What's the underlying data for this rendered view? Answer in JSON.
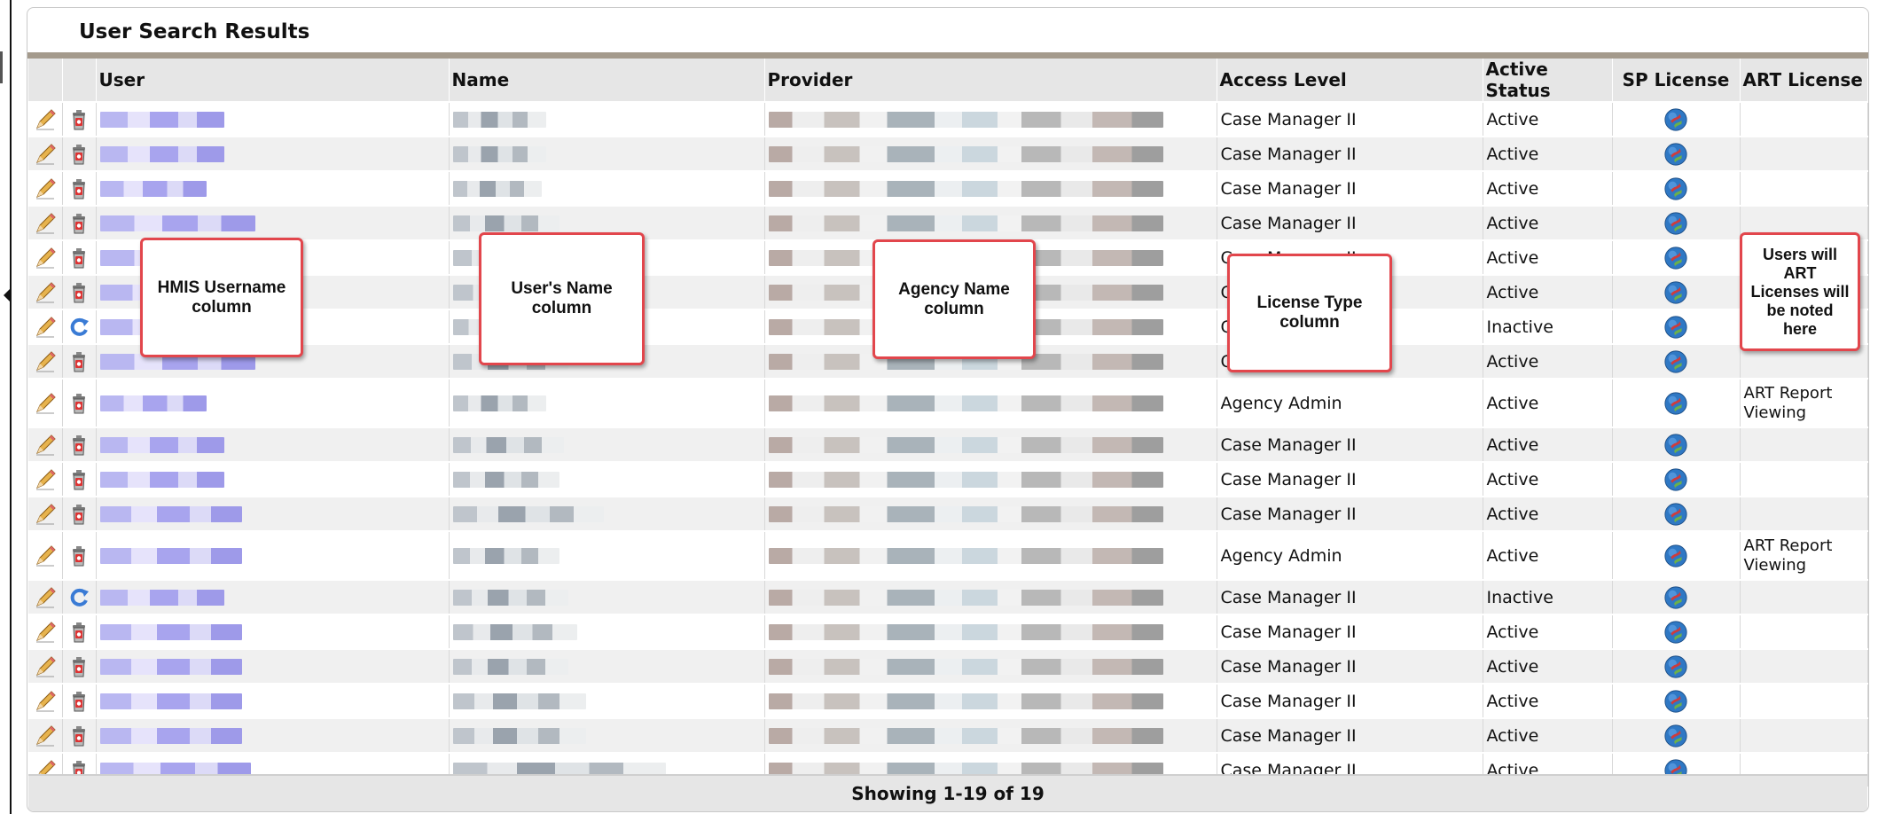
{
  "panel": {
    "title": "User Search Results"
  },
  "columns": {
    "user": "User",
    "name": "Name",
    "provider": "Provider",
    "access_level": "Access Level",
    "active_status": "Active Status",
    "sp_license": "SP License",
    "art_license": "ART License"
  },
  "rows": [
    {
      "action": "delete-icon",
      "access_level": "Case Manager II",
      "status": "Active",
      "art_license": ""
    },
    {
      "action": "delete-icon",
      "access_level": "Case Manager II",
      "status": "Active",
      "art_license": ""
    },
    {
      "action": "delete-icon",
      "access_level": "Case Manager II",
      "status": "Active",
      "art_license": ""
    },
    {
      "action": "delete-icon",
      "access_level": "Case Manager II",
      "status": "Active",
      "art_license": ""
    },
    {
      "action": "delete-icon",
      "access_level": "Case Manager II",
      "status": "Active",
      "art_license": ""
    },
    {
      "action": "delete-icon",
      "access_level": "Case Manager II",
      "status": "Active",
      "art_license": ""
    },
    {
      "action": "activate-icon",
      "access_level": "Case Manager II",
      "status": "Inactive",
      "art_license": ""
    },
    {
      "action": "delete-icon",
      "access_level": "Case Manager II",
      "status": "Active",
      "art_license": ""
    },
    {
      "action": "delete-icon",
      "access_level": "Agency Admin",
      "status": "Active",
      "art_license": "ART Report Viewing"
    },
    {
      "action": "delete-icon",
      "access_level": "Case Manager II",
      "status": "Active",
      "art_license": ""
    },
    {
      "action": "delete-icon",
      "access_level": "Case Manager II",
      "status": "Active",
      "art_license": ""
    },
    {
      "action": "delete-icon",
      "access_level": "Case Manager II",
      "status": "Active",
      "art_license": ""
    },
    {
      "action": "delete-icon",
      "access_level": "Agency Admin",
      "status": "Active",
      "art_license": "ART Report Viewing"
    },
    {
      "action": "activate-icon",
      "access_level": "Case Manager II",
      "status": "Inactive",
      "art_license": ""
    },
    {
      "action": "delete-icon",
      "access_level": "Case Manager II",
      "status": "Active",
      "art_license": ""
    },
    {
      "action": "delete-icon",
      "access_level": "Case Manager II",
      "status": "Active",
      "art_license": ""
    },
    {
      "action": "delete-icon",
      "access_level": "Case Manager II",
      "status": "Active",
      "art_license": ""
    },
    {
      "action": "delete-icon",
      "access_level": "Case Manager II",
      "status": "Active",
      "art_license": ""
    },
    {
      "action": "delete-icon",
      "access_level": "Case Manager II",
      "status": "Active",
      "art_license": ""
    }
  ],
  "footer": {
    "text": "Showing 1-19 of 19"
  },
  "callouts": {
    "username": "HMIS Username\ncolumn",
    "name": "User's Name\ncolumn",
    "agency": "Agency Name\ncolumn",
    "license": "License Type\ncolumn",
    "art": "Users will\nART\nLicenses will\nbe noted\nhere"
  },
  "colors": {
    "callout_border": "#e2464c",
    "title_rule": "#a49a8c",
    "header_bg": "#e6e6e6"
  }
}
